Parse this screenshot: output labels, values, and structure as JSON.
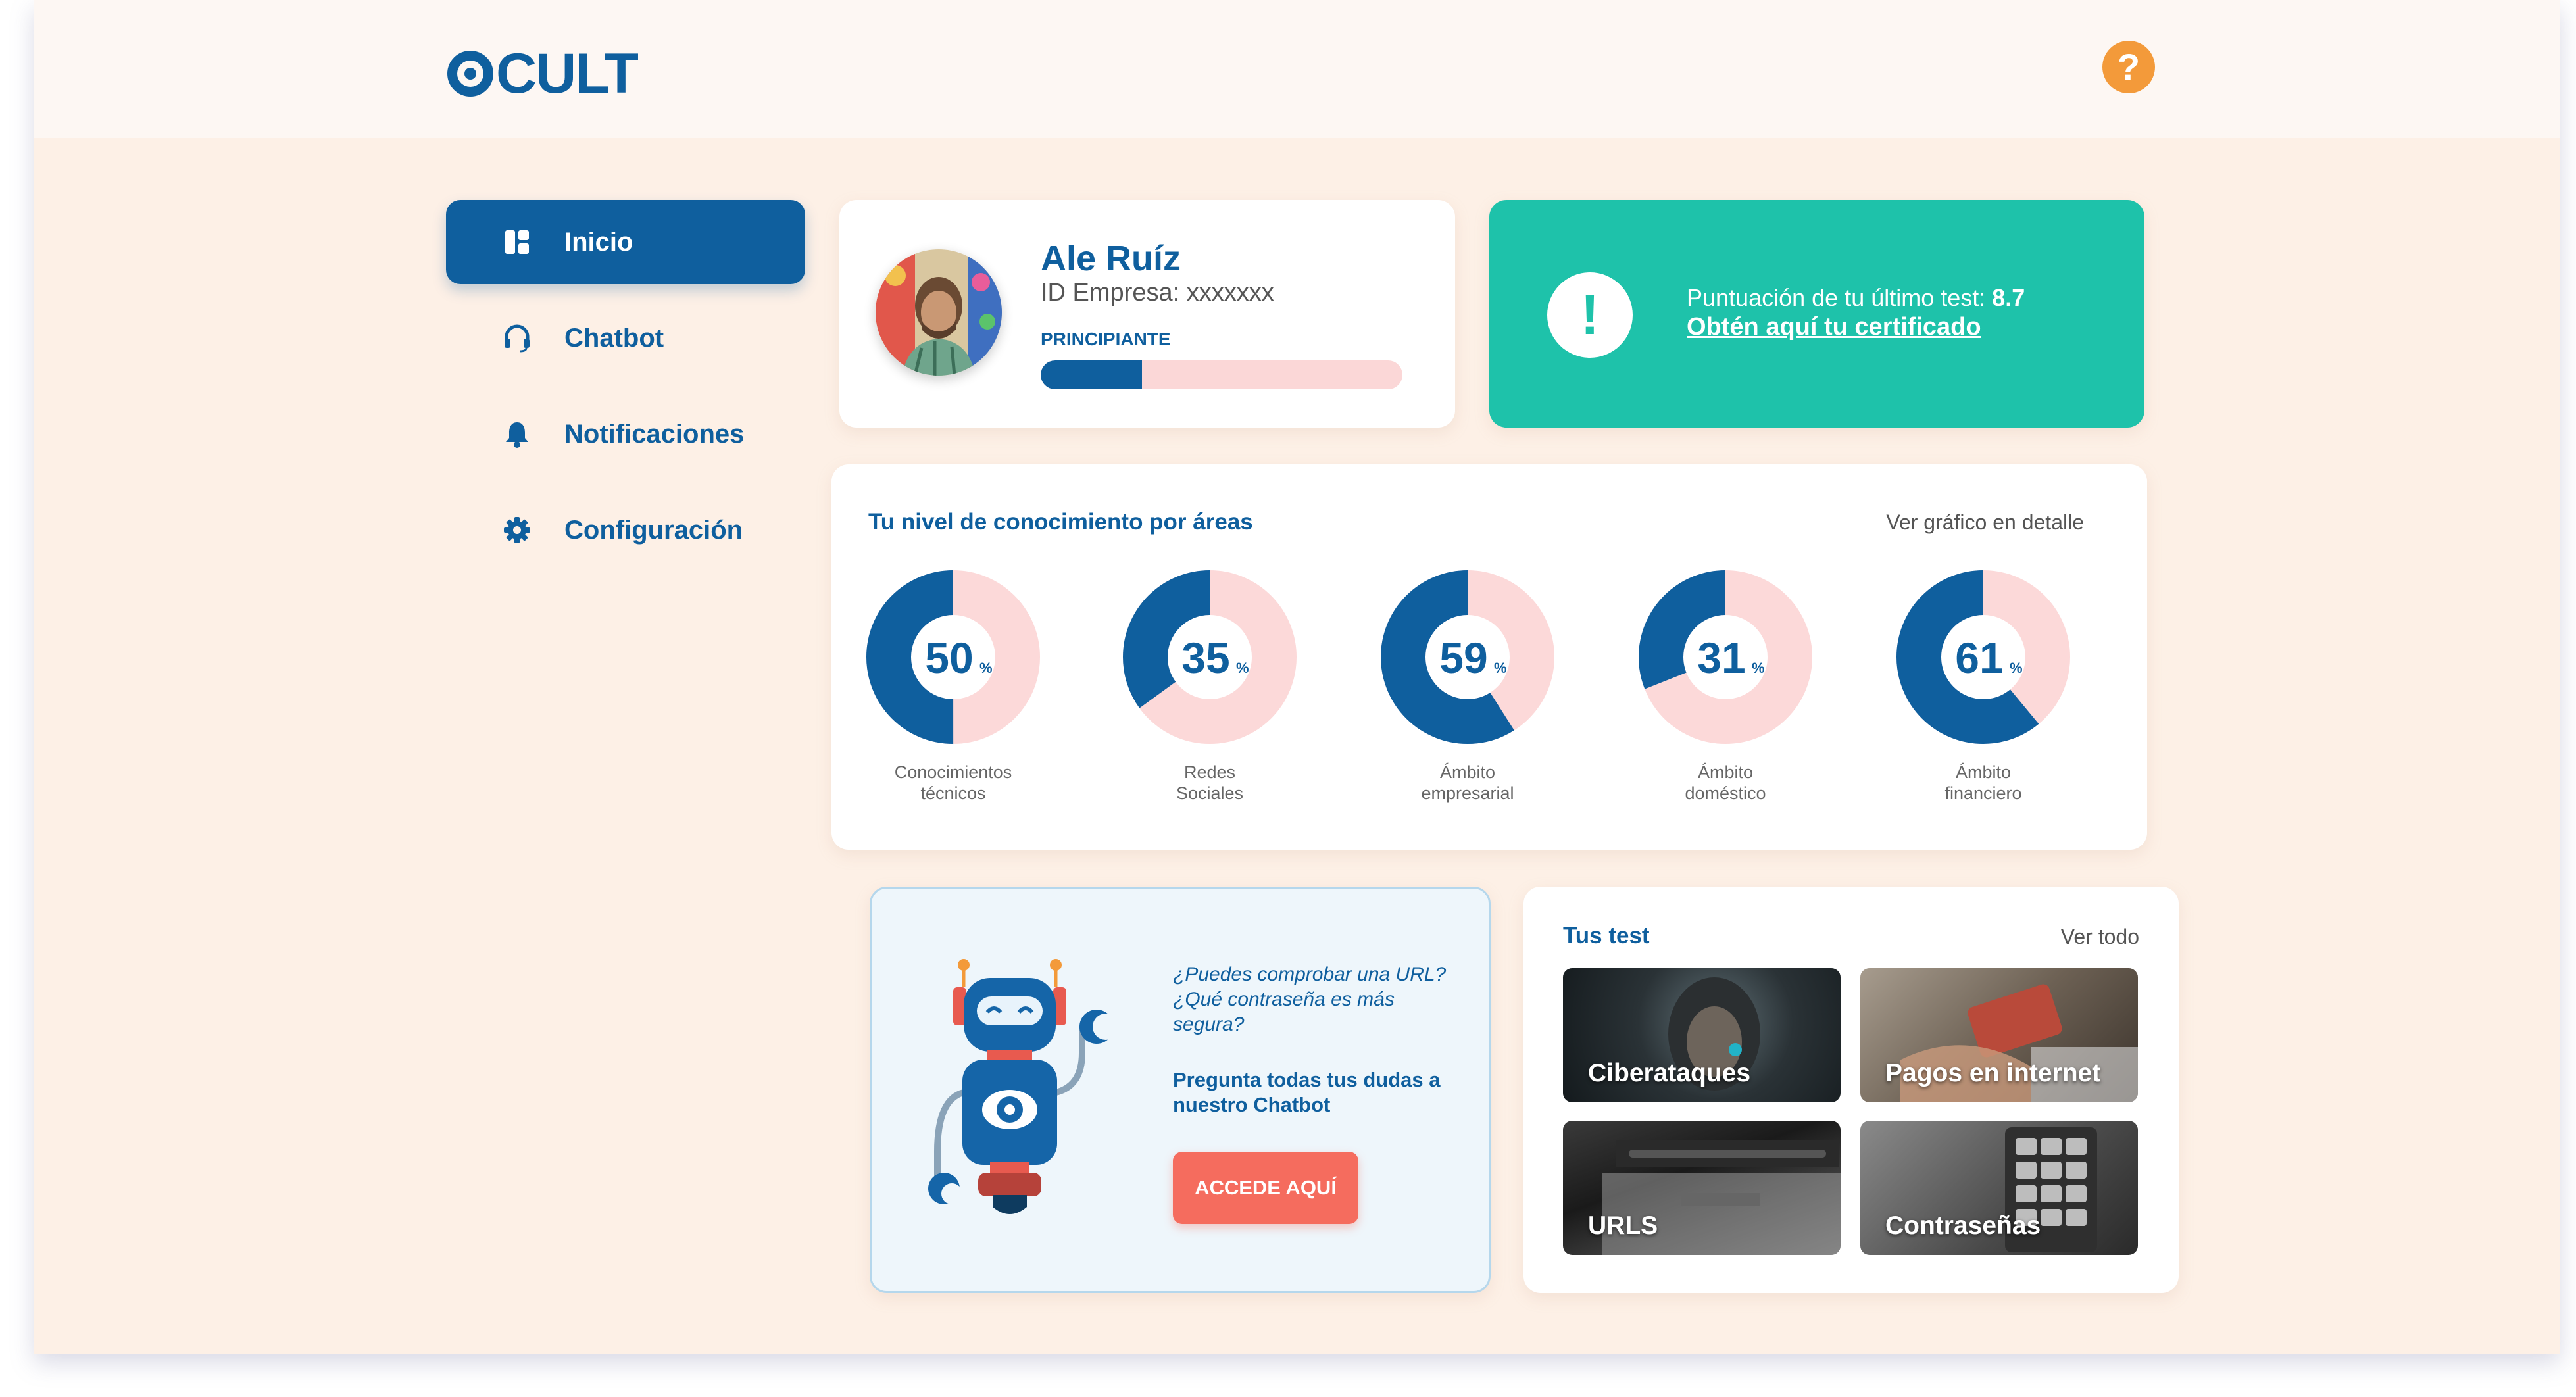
{
  "brand": {
    "logo_text": "CULT",
    "primary_color": "#0f5f9e",
    "accent_teal": "#1ec2aa",
    "accent_coral": "#f56c5e",
    "help_color": "#f39a3a"
  },
  "header": {
    "help_symbol": "?"
  },
  "sidebar": {
    "items": [
      {
        "label": "Inicio",
        "icon": "dashboard-icon",
        "active": true
      },
      {
        "label": "Chatbot",
        "icon": "headset-icon",
        "active": false
      },
      {
        "label": "Notificaciones",
        "icon": "bell-icon",
        "active": false
      },
      {
        "label": "Configuración",
        "icon": "gear-icon",
        "active": false
      }
    ]
  },
  "profile": {
    "name": "Ale Ruíz",
    "company_id": "ID Empresa: xxxxxxx",
    "level": "PRINCIPIANTE",
    "level_progress": 0.28
  },
  "score_card": {
    "icon": "!",
    "last_test_prefix": "Puntuación de tu último test: ",
    "last_test_score": "8.7",
    "certificate_link": "Obtén aquí tu certificado"
  },
  "knowledge": {
    "title": "Tu nivel de conocimiento por áreas",
    "detail_link": "Ver gráfico en detalle",
    "areas": [
      {
        "value": 50,
        "label": "Conocimientos\ntécnicos"
      },
      {
        "value": 35,
        "label": "Redes\nSociales"
      },
      {
        "value": 59,
        "label": "Ámbito\nempresarial"
      },
      {
        "value": 31,
        "label": "Ámbito\ndoméstico"
      },
      {
        "value": 61,
        "label": "Ámbito\nfinanciero"
      }
    ],
    "unit": "%"
  },
  "chatbot_card": {
    "question": "¿Puedes comprobar una URL? ¿Qué contraseña es más segura?",
    "cta_text": "Pregunta todas tus dudas a nuestro Chatbot",
    "button_label": "ACCEDE AQUÍ"
  },
  "tests": {
    "title": "Tus test",
    "see_all": "Ver todo",
    "items": [
      {
        "label": "Ciberataques"
      },
      {
        "label": "Pagos en internet"
      },
      {
        "label": "URLS"
      },
      {
        "label": "Contraseñas"
      }
    ]
  }
}
